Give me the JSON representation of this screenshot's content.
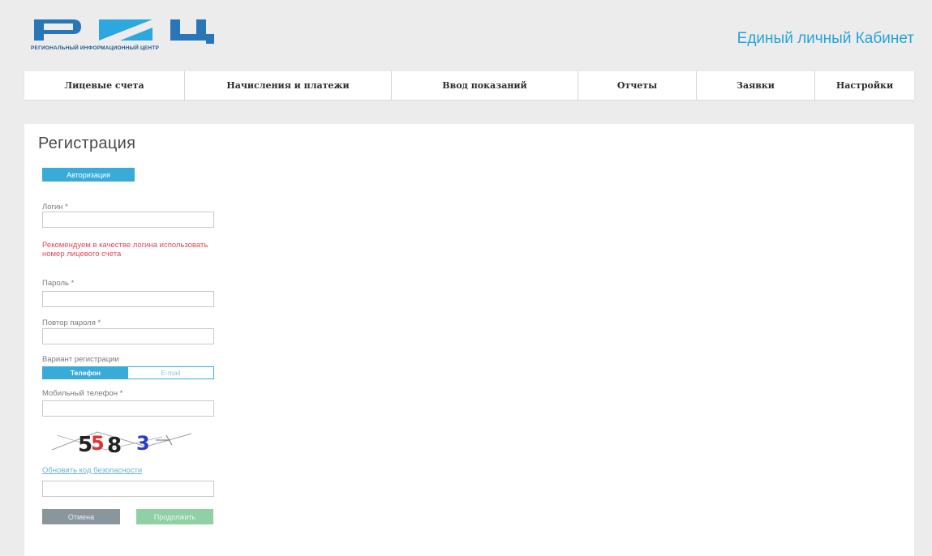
{
  "header": {
    "logo_caption": "РЕГИОНАЛЬНЫЙ ИНФОРМАЦИОННЫЙ ЦЕНТР",
    "cabinet_title": "Единый личный Кабинет",
    "colors": {
      "logo_blue": "#2876b8",
      "logo_accent": "#2ca8de",
      "title": "#26a4d8"
    }
  },
  "nav": {
    "items": [
      {
        "label": "Лицевые счета"
      },
      {
        "label": "Начисления и платежи"
      },
      {
        "label": "Ввод показаний"
      },
      {
        "label": "Отчеты"
      },
      {
        "label": "Заявки"
      },
      {
        "label": "Настройки"
      }
    ]
  },
  "form": {
    "title": "Регистрация",
    "auth_button": "Авторизация",
    "login_label": "Логин *",
    "login_value": "",
    "login_hint": "Рекомендуем в качестве логина использовать номер лицевого счета",
    "password_label": "Пароль *",
    "password_repeat_label": "Повтор пароля *",
    "reg_variant_label": "Вариант регистрации",
    "reg_options": [
      {
        "label": "Телефон",
        "selected": true
      },
      {
        "label": "E-mail",
        "selected": false
      }
    ],
    "mobile_label": "Мобильный телефон *",
    "captcha_text": "5583",
    "refresh_link": "Обновить код безопасности",
    "cancel_button": "Отмена",
    "continue_button": "Продолжить",
    "colors": {
      "accent": "#39abd9",
      "hint": "#e0465a",
      "cancel": "#8a969c",
      "continue": "#8fd0a4"
    }
  }
}
